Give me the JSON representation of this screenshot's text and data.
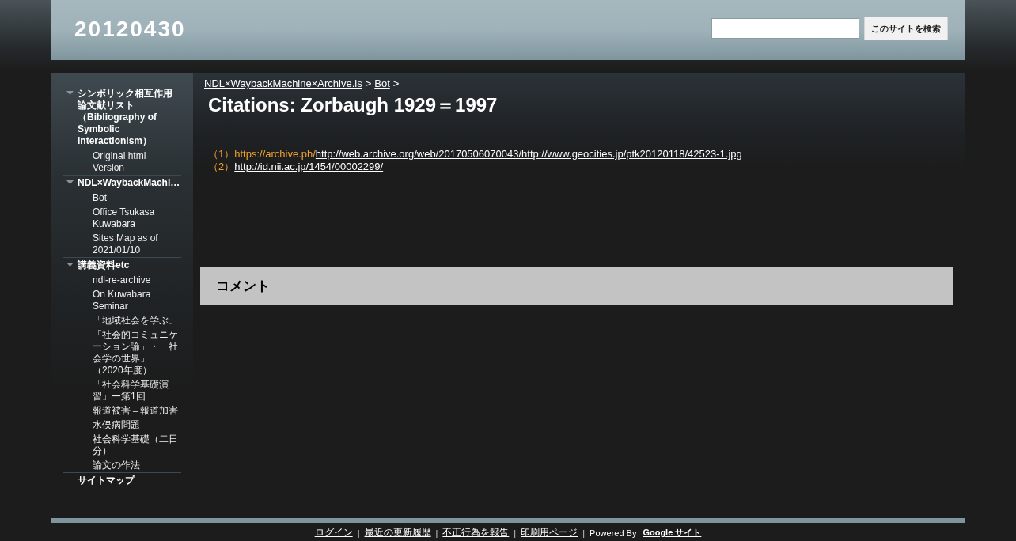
{
  "header": {
    "site_title": "20120430",
    "search": {
      "button": "このサイトを検索"
    }
  },
  "sidebar": {
    "items": [
      {
        "label": "シンボリック相互作用論文献リスト（Bibliography of Symbolic Interactionism）",
        "expanded": true,
        "children": [
          {
            "label": "Original html Version"
          }
        ]
      },
      {
        "label": "NDL×WaybackMachi…",
        "expanded": true,
        "children": [
          {
            "label": "Bot"
          },
          {
            "label": "Office Tsukasa Kuwabara"
          },
          {
            "label": "Sites Map as of 2021/01/10"
          }
        ]
      },
      {
        "label": "講義資料etc",
        "expanded": true,
        "children": [
          {
            "label": "ndl-re-archive"
          },
          {
            "label": "On Kuwabara Seminar"
          },
          {
            "label": "「地域社会を学ぶ」"
          },
          {
            "label": "「社会的コミュニケーション論」・「社会学の世界」（2020年度）"
          },
          {
            "label": "「社会科学基礎演習」ー第1回"
          },
          {
            "label": "報道被害＝報道加害"
          },
          {
            "label": "水俣病問題"
          },
          {
            "label": "社会科学基礎（二日分）"
          },
          {
            "label": "論文の作法"
          }
        ]
      },
      {
        "label": "サイトマップ"
      }
    ]
  },
  "breadcrumb": {
    "links": [
      "NDL×WaybackMachine×Archive.is",
      "Bot"
    ],
    "separator": ">"
  },
  "page_title": "Citations: Zorbaugh 1929＝1997",
  "citations": [
    {
      "number": "（1）",
      "prefix": "https://archive.ph/",
      "link": "http://web.archive.org/web/20170506070043/http://www.geocities.jp/ptk20120118/42523-1.jpg"
    },
    {
      "number": "（2）",
      "link": "http://id.nii.ac.jp/1454/00002299/"
    }
  ],
  "comments": {
    "title": "コメント"
  },
  "footer": {
    "links": [
      "ログイン",
      "最近の更新履歴",
      "不正行為を報告",
      "印刷用ページ"
    ],
    "separator": "|",
    "powered_by": "Powered By",
    "brand_link": "Google サイト"
  }
}
